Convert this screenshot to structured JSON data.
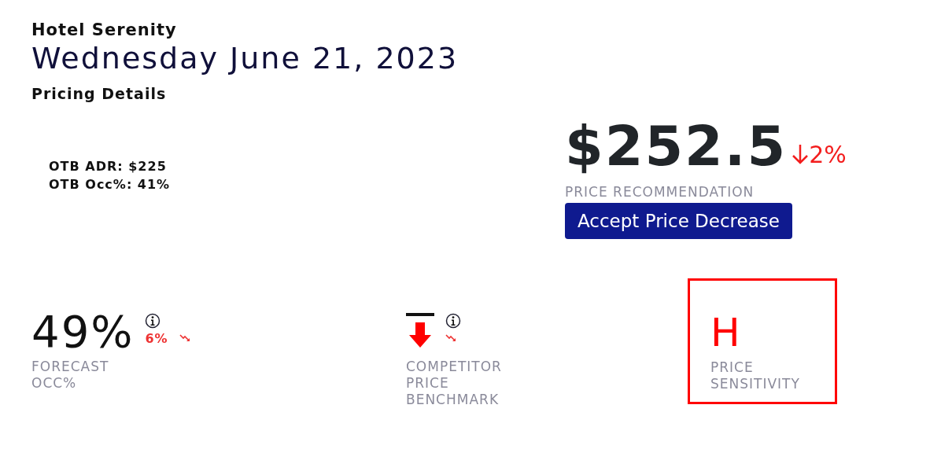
{
  "hotel": "Hotel Serenity",
  "date": "Wednesday June 21, 2023",
  "section_title": "Pricing Details",
  "otb": [
    "OTB ADR: $225",
    "OTB Occ%: 41%"
  ],
  "recommendation": {
    "price": "$252.5",
    "decrease": true,
    "change": "2%",
    "label": "PRICE RECOMMENDATION",
    "button": "Accept Price Decrease"
  },
  "metrics": [
    {
      "kind": "value",
      "value": "49%",
      "change": "6%",
      "trending_down": true,
      "info": true,
      "label": "FORECAST OCC%"
    },
    {
      "kind": "arrow",
      "below_benchmark": true,
      "trending_down": true,
      "info": true,
      "label": "COMPETITOR PRICE BENCHMARK"
    },
    {
      "kind": "letter",
      "value": "H",
      "label": "PRICE SENSITIVITY",
      "highlighted": true
    }
  ]
}
